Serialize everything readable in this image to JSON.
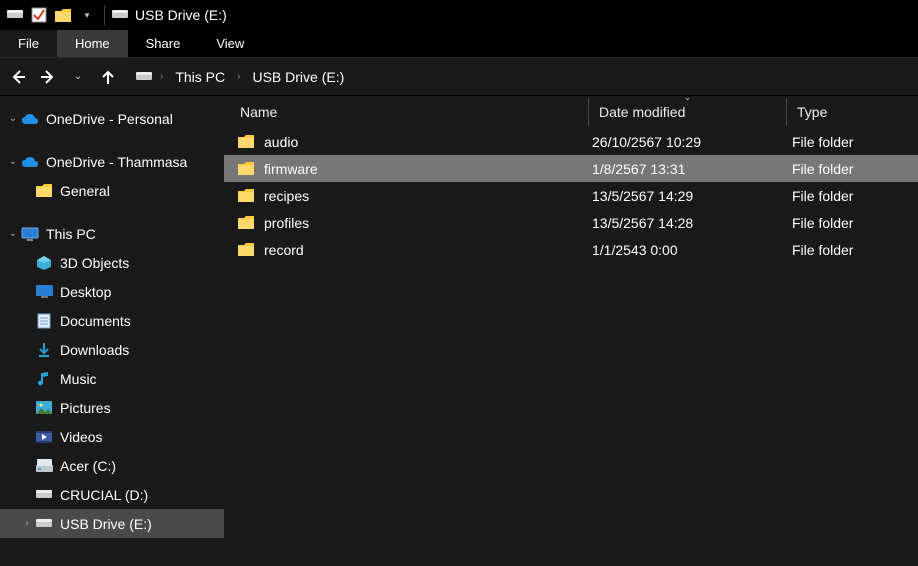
{
  "titlebar": {
    "window_title": "USB Drive (E:)"
  },
  "ribbon": {
    "file": "File",
    "home": "Home",
    "share": "Share",
    "view": "View"
  },
  "breadcrumb": {
    "root": "This PC",
    "current": "USB Drive (E:)"
  },
  "columns": {
    "name": "Name",
    "date": "Date modified",
    "type": "Type"
  },
  "sidebar": {
    "onedrive_personal": "OneDrive - Personal",
    "onedrive_thammasat": "OneDrive - Thammasa",
    "general": "General",
    "this_pc": "This PC",
    "objects3d": "3D Objects",
    "desktop": "Desktop",
    "documents": "Documents",
    "downloads": "Downloads",
    "music": "Music",
    "pictures": "Pictures",
    "videos": "Videos",
    "acer": "Acer (C:)",
    "crucial": "CRUCIAL (D:)",
    "usb": "USB Drive (E:)"
  },
  "files": [
    {
      "name": "audio",
      "date": "26/10/2567 10:29",
      "type": "File folder",
      "selected": false
    },
    {
      "name": "firmware",
      "date": "1/8/2567 13:31",
      "type": "File folder",
      "selected": true
    },
    {
      "name": "recipes",
      "date": "13/5/2567 14:29",
      "type": "File folder",
      "selected": false
    },
    {
      "name": "profiles",
      "date": "13/5/2567 14:28",
      "type": "File folder",
      "selected": false
    },
    {
      "name": "record",
      "date": "1/1/2543 0:00",
      "type": "File folder",
      "selected": false
    }
  ]
}
